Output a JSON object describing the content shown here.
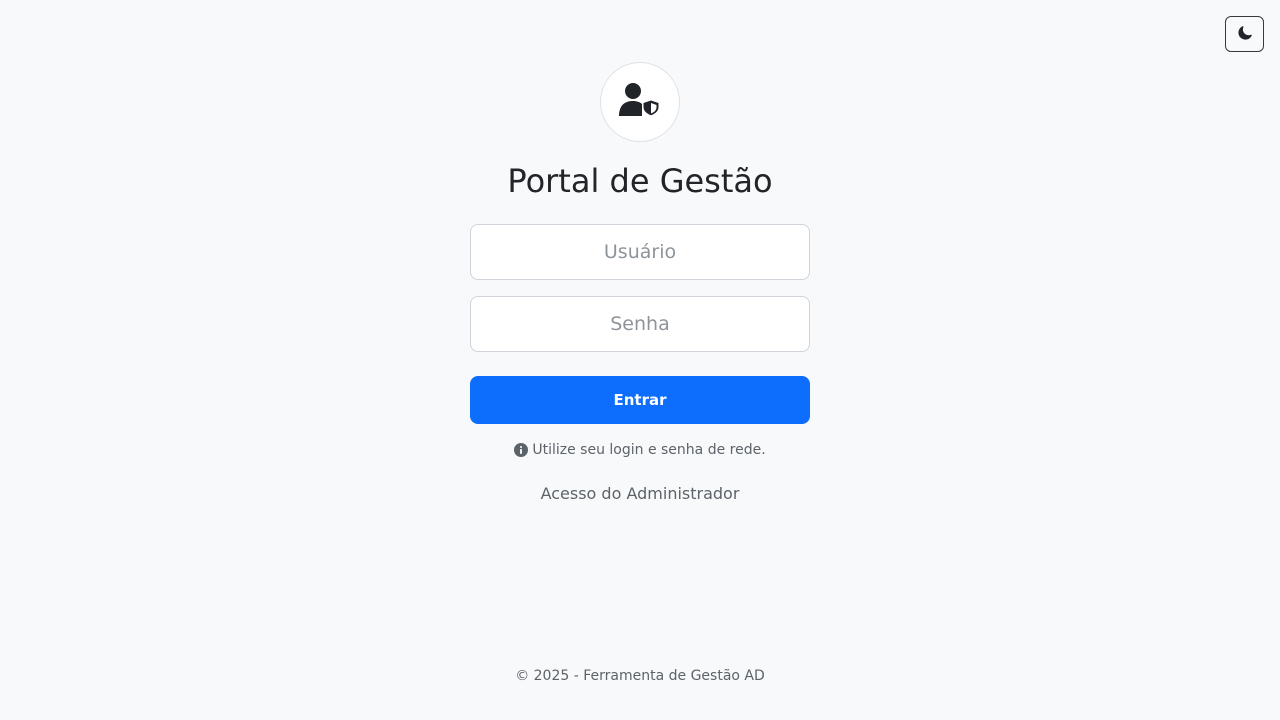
{
  "header": {
    "theme_toggle_icon": "moon-icon"
  },
  "logo": {
    "icon": "user-shield-icon"
  },
  "login": {
    "title": "Portal de Gestão",
    "username_placeholder": "Usuário",
    "username_value": "",
    "password_placeholder": "Senha",
    "password_value": "",
    "submit_label": "Entrar",
    "hint_icon": "info-circle-icon",
    "hint_text": "Utilize seu login e senha de rede.",
    "admin_link": "Acesso do Administrador"
  },
  "footer": {
    "text": "© 2025 - Ferramenta de Gestão AD"
  },
  "colors": {
    "background": "#f8f9fa",
    "primary": "#0d6efd",
    "muted_text": "#5c636a"
  }
}
